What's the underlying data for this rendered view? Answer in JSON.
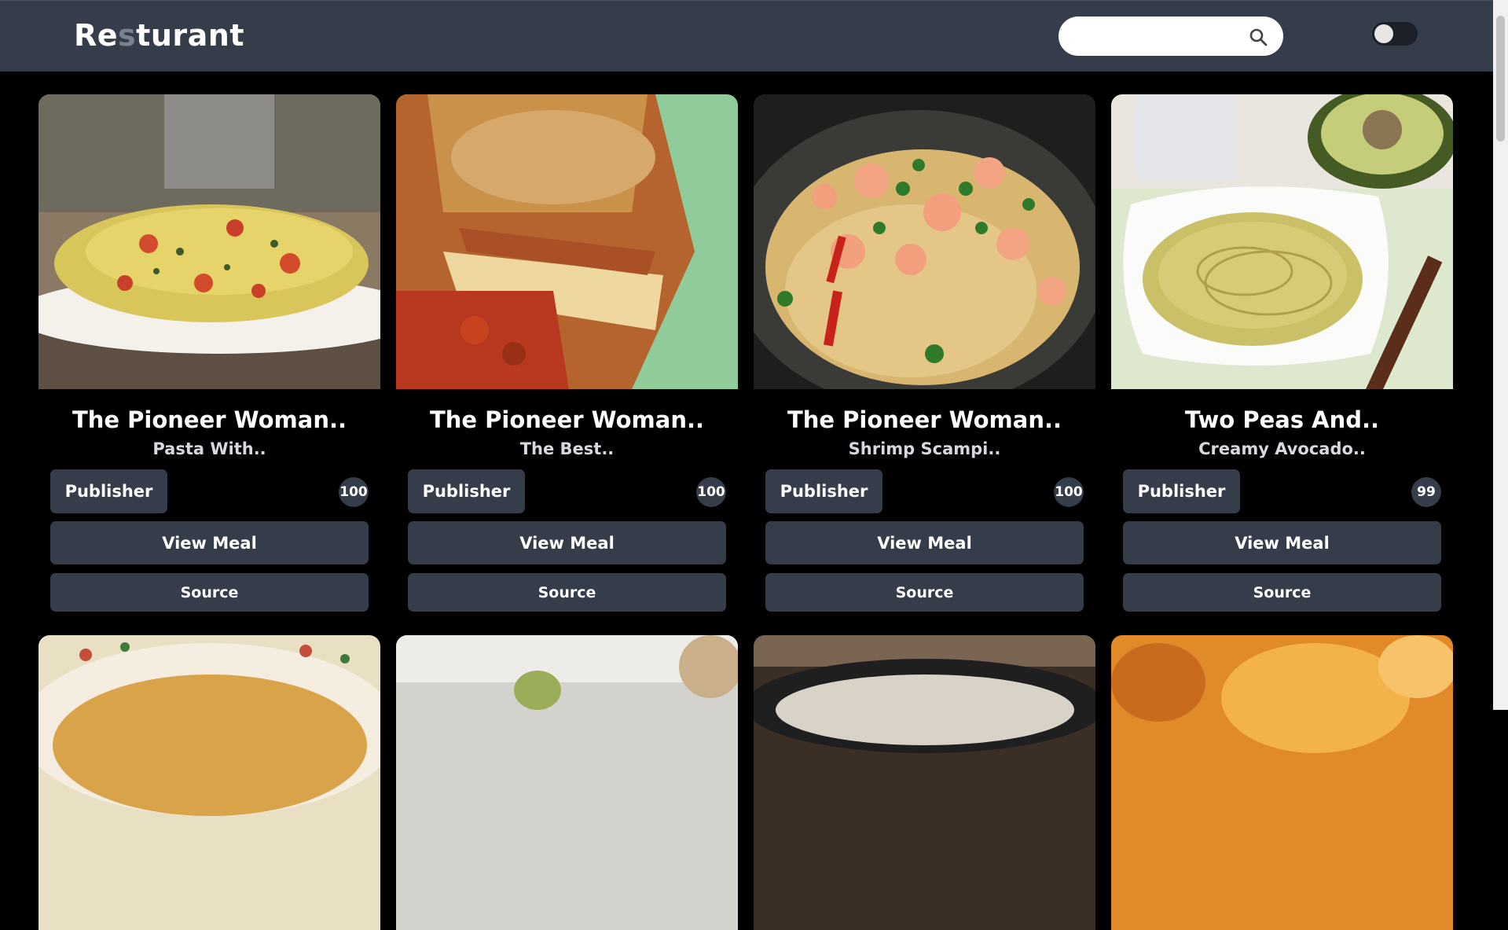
{
  "brand": {
    "prefix": "Re",
    "dim": "s",
    "suffix": "turant"
  },
  "search": {
    "placeholder": "",
    "icon": "search-icon"
  },
  "theme_toggle": {
    "state": "off"
  },
  "cards": [
    {
      "title": "The Pioneer Woman..",
      "subtitle": "Pasta With..",
      "publisher_label": "Publisher",
      "score": "100",
      "view_label": "View Meal",
      "source_label": "Source"
    },
    {
      "title": "The Pioneer Woman..",
      "subtitle": "The Best..",
      "publisher_label": "Publisher",
      "score": "100",
      "view_label": "View Meal",
      "source_label": "Source"
    },
    {
      "title": "The Pioneer Woman..",
      "subtitle": "Shrimp Scampi..",
      "publisher_label": "Publisher",
      "score": "100",
      "view_label": "View Meal",
      "source_label": "Source"
    },
    {
      "title": "Two Peas And..",
      "subtitle": "Creamy Avocado..",
      "publisher_label": "Publisher",
      "score": "99",
      "view_label": "View Meal",
      "source_label": "Source"
    }
  ],
  "colors": {
    "navbar": "#353c4a",
    "background": "#000000",
    "button": "#353c4a",
    "text": "#ffffff"
  }
}
